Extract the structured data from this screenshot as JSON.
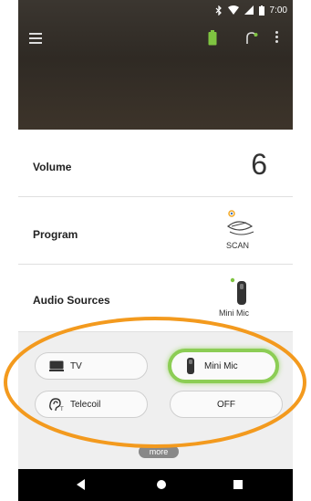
{
  "status_bar": {
    "time": "7:00",
    "icons": [
      "bluetooth-icon",
      "wifi-icon",
      "signal-icon",
      "battery-icon"
    ]
  },
  "app_bar": {
    "icons": [
      "menu-icon",
      "hearing-aid-battery-icon",
      "hearing-aid-icon",
      "overflow-menu-icon"
    ]
  },
  "rows": {
    "volume": {
      "label": "Volume",
      "value": "6"
    },
    "program": {
      "label": "Program",
      "value": "SCAN"
    },
    "audio_sources": {
      "label": "Audio Sources",
      "value": "Mini Mic"
    }
  },
  "sources": {
    "tv": "TV",
    "mini_mic": "Mini Mic",
    "telecoil": "Telecoil",
    "off": "OFF",
    "more": "more"
  },
  "colors": {
    "accent_green": "#8ccd55",
    "highlight_orange": "#f39a1e",
    "header_brown": "#3b3630"
  }
}
